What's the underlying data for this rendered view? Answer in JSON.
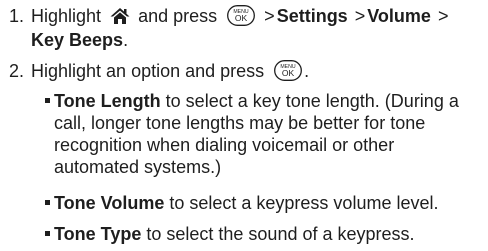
{
  "steps": [
    {
      "number": "1.",
      "text_a": "Highlight",
      "text_b": "and press",
      "path": [
        "Settings",
        "Volume",
        "Key Beeps"
      ],
      "separator": ">",
      "end": "."
    },
    {
      "number": "2.",
      "text_a": "Highlight an option and press",
      "end": "."
    }
  ],
  "key_label": {
    "top": "MENU",
    "bottom": "OK"
  },
  "icons": {
    "home": "home-icon",
    "menu_ok_key": "menu-ok-key-icon"
  },
  "options": [
    {
      "term": "Tone Length",
      "line1": "to select a key tone length. (During a",
      "line2": "call, longer tone lengths may be better for tone",
      "line3": "recognition when dialing voicemail or other",
      "line4": "automated systems.)"
    },
    {
      "term": "Tone Volume",
      "line1": "to select a keypress volume level."
    },
    {
      "term": "Tone Type",
      "line1": "to select the sound of a keypress."
    }
  ]
}
